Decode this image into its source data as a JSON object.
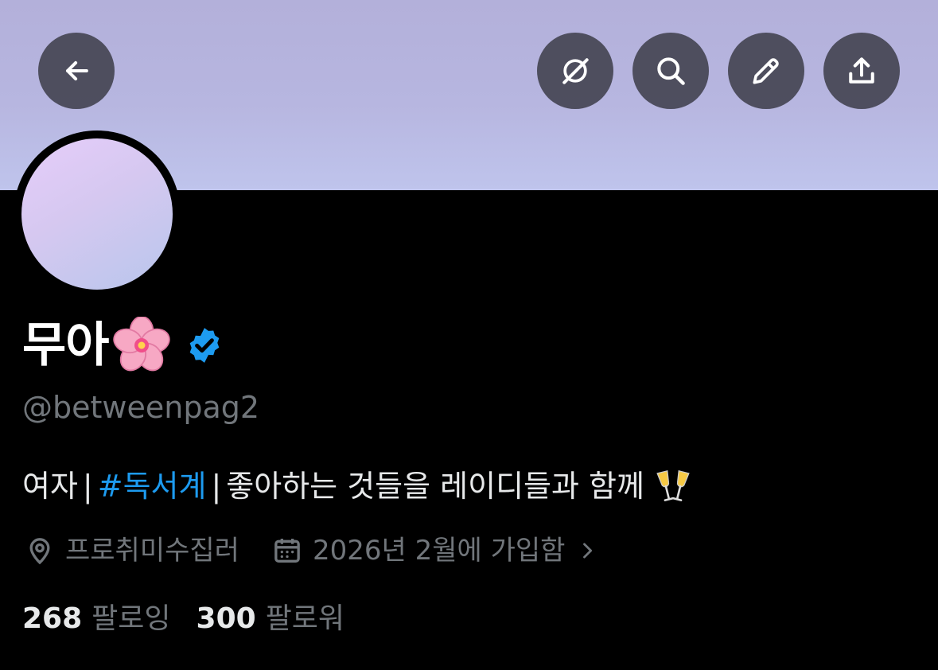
{
  "header": {
    "buttons": [
      {
        "icon": "back-arrow-icon"
      },
      {
        "icon": "grok-icon"
      },
      {
        "icon": "search-icon"
      },
      {
        "icon": "edit-pencil-icon"
      },
      {
        "icon": "share-icon"
      }
    ]
  },
  "profile": {
    "display_name": "무아",
    "name_emoji": "cherry-blossom",
    "verified": true,
    "handle": "@betweenpag2",
    "bio": {
      "part1": "여자",
      "separator": "|",
      "hashtag": "#독서계",
      "part2": "좋아하는 것들을 레이디들과 함께",
      "emoji": "clinking-glasses"
    },
    "location": "프로취미수집러",
    "joined": "2026년 2월에 가입함"
  },
  "stats": {
    "following_count": "268",
    "following_label": "팔로잉",
    "followers_count": "300",
    "followers_label": "팔로워"
  },
  "colors": {
    "background": "#000000",
    "text_primary": "#e7e9ea",
    "text_secondary": "#71767b",
    "accent": "#1d9bf0"
  }
}
